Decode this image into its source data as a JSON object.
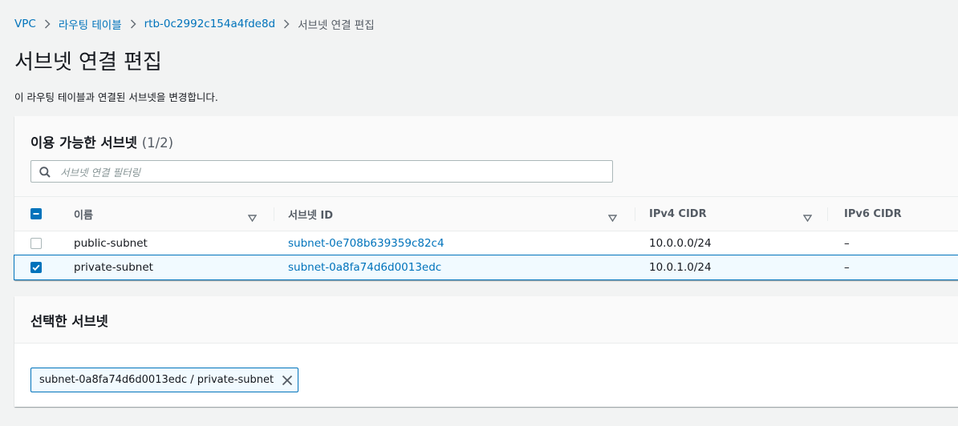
{
  "breadcrumb": {
    "items": [
      "VPC",
      "라우팅 테이블",
      "rtb-0c2992c154a4fde8d"
    ],
    "current": "서브넷 연결 편집"
  },
  "page": {
    "title": "서브넷 연결 편집",
    "description": "이 라우팅 테이블과 연결된 서브넷을 변경합니다."
  },
  "available": {
    "title": "이용 가능한 서브넷",
    "count": "(1/2)",
    "filter_placeholder": "서브넷 연결 필터링",
    "columns": [
      "이름",
      "서브넷 ID",
      "IPv4 CIDR",
      "IPv6 CIDR"
    ],
    "rows": [
      {
        "name": "public-subnet",
        "subnet_id": "subnet-0e708b639359c82c4",
        "ipv4": "10.0.0.0/24",
        "ipv6": "–",
        "checked": false
      },
      {
        "name": "private-subnet",
        "subnet_id": "subnet-0a8fa74d6d0013edc",
        "ipv4": "10.0.1.0/24",
        "ipv6": "–",
        "checked": true
      }
    ]
  },
  "selected": {
    "title": "선택한 서브넷",
    "tokens": [
      "subnet-0a8fa74d6d0013edc / private-subnet"
    ]
  },
  "colors": {
    "link": "#0073bb",
    "selected_row_bg": "#f1faff",
    "background": "#f2f3f3"
  }
}
